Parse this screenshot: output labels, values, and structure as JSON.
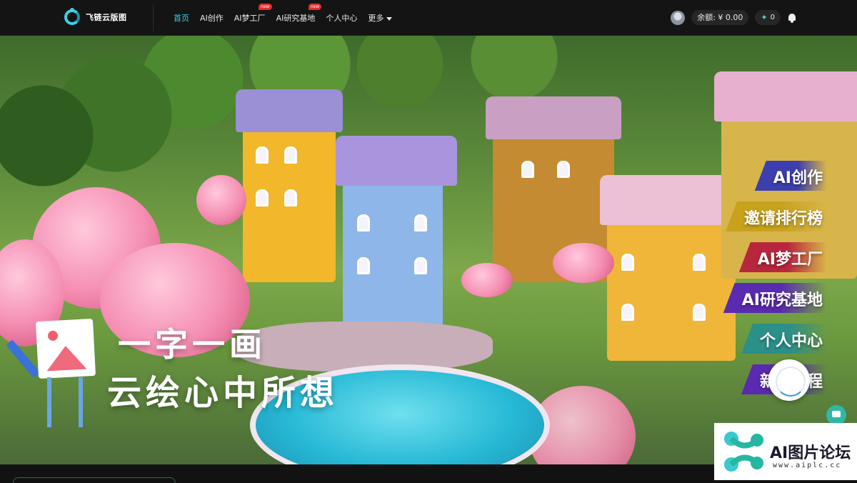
{
  "brand": {
    "name": "飞链云版图",
    "accent": "#3fd0e6"
  },
  "nav": {
    "items": [
      {
        "label": "首页",
        "active": true,
        "badge": ""
      },
      {
        "label": "AI创作",
        "active": false,
        "badge": ""
      },
      {
        "label": "AI梦工厂",
        "active": false,
        "badge": "new"
      },
      {
        "label": "AI研究基地",
        "active": false,
        "badge": "new"
      },
      {
        "label": "个人中心",
        "active": false,
        "badge": ""
      }
    ],
    "more_label": "更多"
  },
  "user": {
    "balance": "余额: ¥ 0.00",
    "points": "0"
  },
  "hero": {
    "slogan_line1": "一字一画",
    "slogan_line2": "云绘心中所想"
  },
  "side_menu": [
    {
      "label": "AI创作",
      "color": "#3d3fae"
    },
    {
      "label": "邀请排行榜",
      "color": "#c9a21d"
    },
    {
      "label": "AI梦工厂",
      "color": "#b8263d"
    },
    {
      "label": "AI研究基地",
      "color": "#5a2ab0"
    },
    {
      "label": "个人中心",
      "color": "#2b8f8a"
    },
    {
      "label": "新人教程",
      "color": "#5a2ab0"
    }
  ],
  "watermark": {
    "title": "AI图片论坛",
    "url": "www.aiplc.cc"
  }
}
